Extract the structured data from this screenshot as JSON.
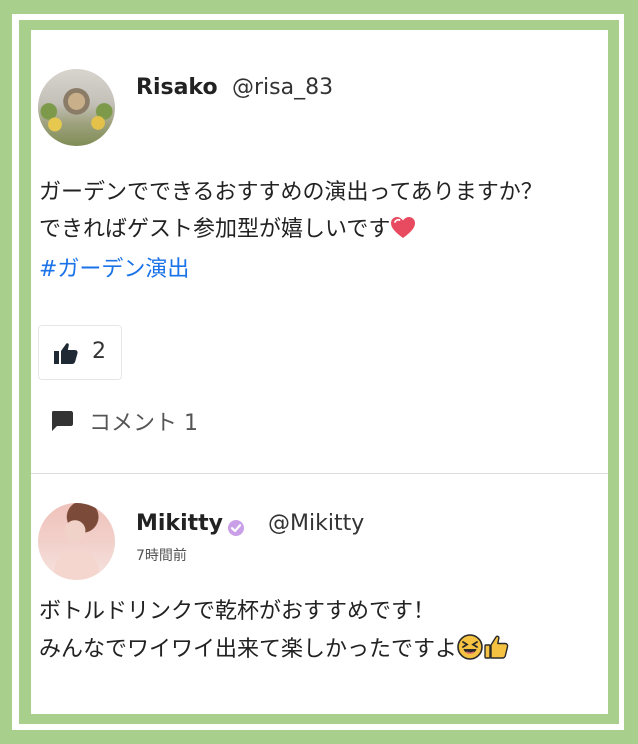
{
  "post": {
    "author_name": "Risako",
    "author_handle": "@risa_83",
    "text_line1": "ガーデンでできるおすすめの演出ってありますか？",
    "text_line2": "できればゲスト参加型が嬉しいです",
    "hashtag": "#ガーデン演出",
    "like_count": "2",
    "comment_label": "コメント 1"
  },
  "comment": {
    "author_name": "Mikitty",
    "author_handle": "@Mikitty",
    "timestamp": "7時間前",
    "text_line1": "ボトルドリンクで乾杯がおすすめです！",
    "text_line2": "みんなでワイワイ出来て楽しかったですよ"
  },
  "icons": {
    "heart": "heart-emoji",
    "like": "thumbs-up-icon",
    "comment": "comment-bubble-icon",
    "verified": "verified-badge-icon",
    "laughing": "laughing-emoji",
    "thumbs_up_emoji": "thumbs-up-emoji"
  },
  "colors": {
    "frame": "#a8cf8c",
    "hashtag": "#1a73e8",
    "verified": "#c9a0e8"
  }
}
